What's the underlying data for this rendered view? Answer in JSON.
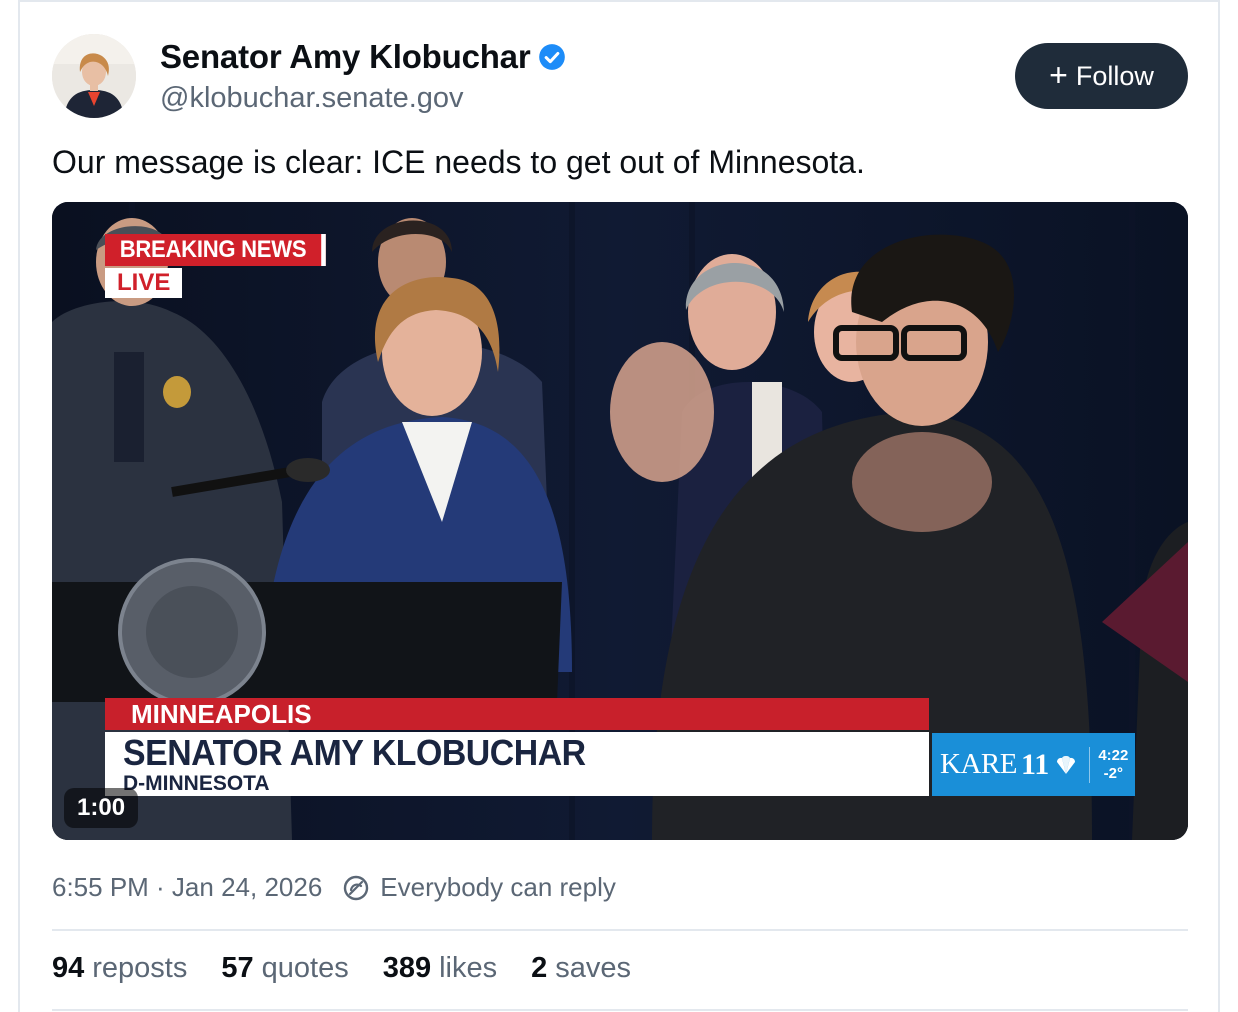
{
  "author": {
    "display_name": "Senator Amy Klobuchar",
    "handle": "@klobuchar.senate.gov",
    "verified": true,
    "accent_color": "#1d8cf8"
  },
  "follow_button": {
    "icon": "plus-icon",
    "label": "Follow"
  },
  "post": {
    "text": "Our message is clear: ICE needs to get out of Minnesota.",
    "video": {
      "breaking_label": "BREAKING NEWS",
      "live_label": "LIVE",
      "location": "MINNEAPOLIS",
      "speaker_name": "SENATOR AMY KLOBUCHAR",
      "speaker_party": "D-MINNESOTA",
      "station_name": "KARE",
      "station_number": "11",
      "station_time": "4:22",
      "station_temp": "-2°",
      "duration": "1:00"
    },
    "timestamp": "6:55 PM · Jan 24, 2026",
    "reply_setting": "Everybody can reply"
  },
  "stats": [
    {
      "count": "94",
      "label": "reposts"
    },
    {
      "count": "57",
      "label": "quotes"
    },
    {
      "count": "389",
      "label": "likes"
    },
    {
      "count": "2",
      "label": "saves"
    }
  ]
}
